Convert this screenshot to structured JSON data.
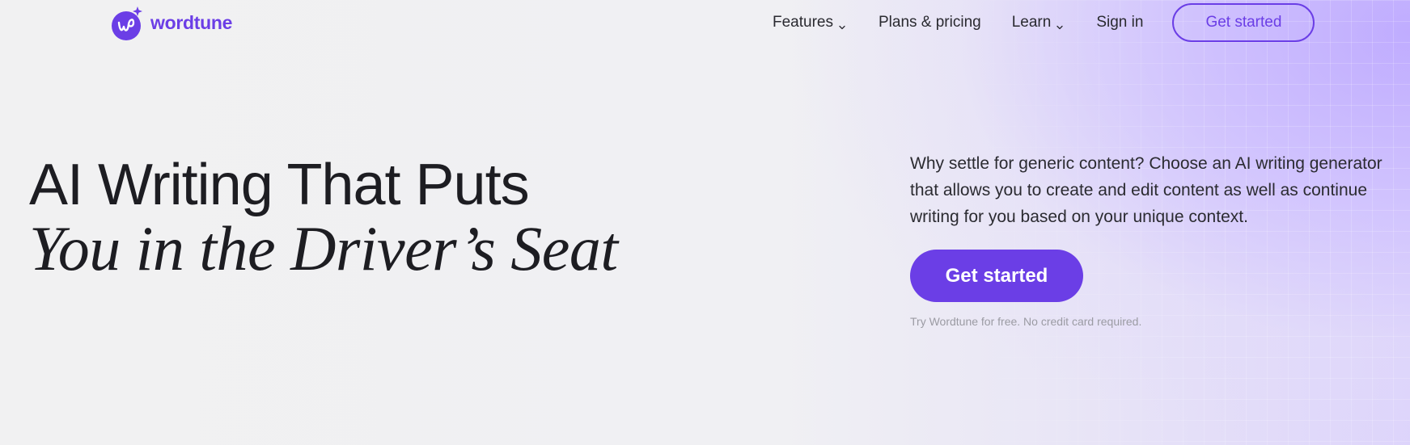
{
  "brand": {
    "name": "wordtune",
    "logo_icon": "wordtune-logo-icon",
    "color": "#6b3ee6"
  },
  "nav": {
    "features": "Features",
    "plans": "Plans & pricing",
    "learn": "Learn",
    "sign_in": "Sign in",
    "get_started": "Get started"
  },
  "hero": {
    "title_line1": "AI Writing That Puts",
    "title_line2": "You in the Driver’s Seat",
    "description": "Why settle for generic content? Choose an AI writing generator that allows you to create and edit content as well as continue writing for you based on your unique context.",
    "cta": "Get started",
    "note": "Try Wordtune for free. No credit card required."
  },
  "colors": {
    "accent": "#6b3ee6",
    "background": "#f1f1f3",
    "gradient": "#c9b8ff"
  }
}
